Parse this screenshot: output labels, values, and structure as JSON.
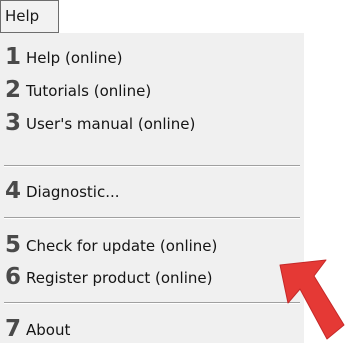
{
  "menu_bar": {
    "help_label": "Help"
  },
  "menu": {
    "items": [
      {
        "number": "1",
        "label": "Help (online)"
      },
      {
        "number": "2",
        "label": "Tutorials (online)"
      },
      {
        "number": "3",
        "label": "User's manual (online)"
      },
      {
        "number": "4",
        "label": "Diagnostic..."
      },
      {
        "number": "5",
        "label": "Check for update (online)"
      },
      {
        "number": "6",
        "label": "Register product (online)"
      },
      {
        "number": "7",
        "label": "About"
      }
    ]
  },
  "annotation": {
    "arrow_color": "#e53935",
    "arrow_icon": "red-arrow-icon"
  },
  "colors": {
    "menu_background": "#f0f0f0",
    "number_color": "#4a4a4a",
    "text_color": "#151515"
  }
}
